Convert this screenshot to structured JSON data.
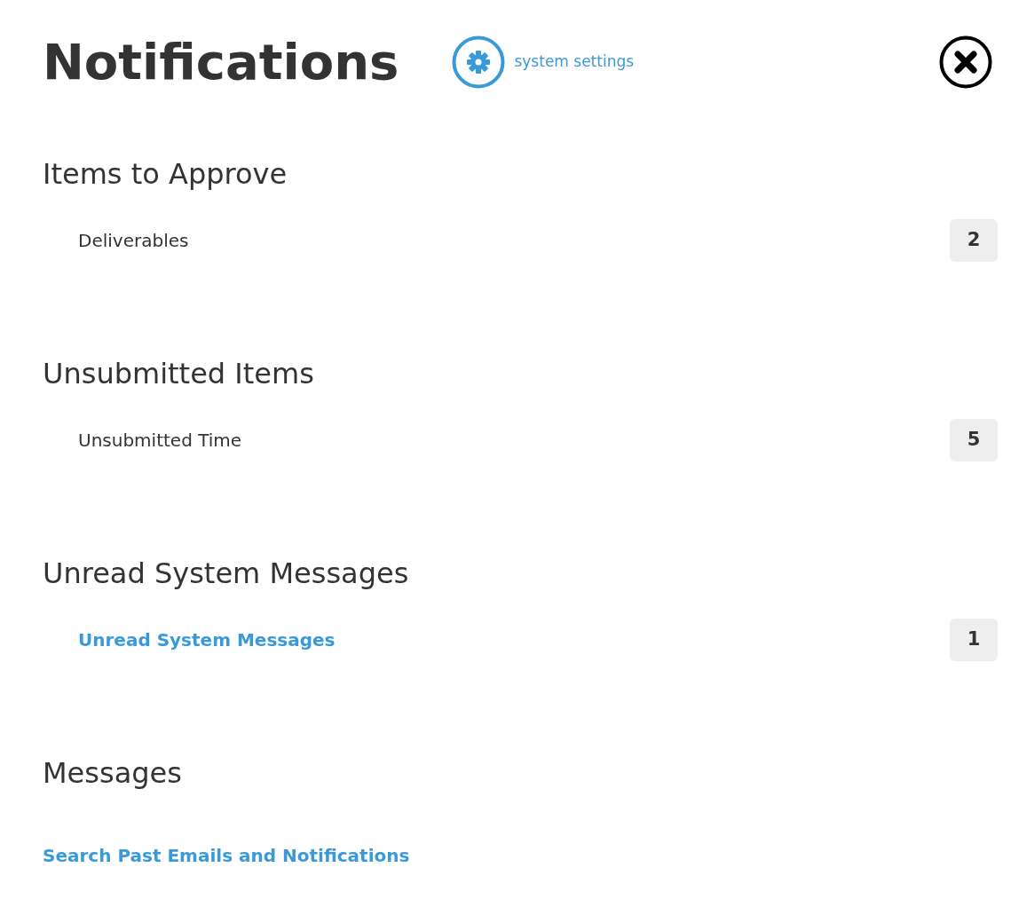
{
  "title": "Notifications",
  "settings_link": "system settings",
  "sections": [
    {
      "heading": "Items to Approve",
      "items": [
        {
          "label": "Deliverables",
          "kind": "text",
          "count": "2"
        }
      ]
    },
    {
      "heading": "Unsubmitted Items",
      "items": [
        {
          "label": "Unsubmitted Time",
          "kind": "text",
          "count": "5"
        }
      ]
    },
    {
      "heading": "Unread System Messages",
      "items": [
        {
          "label": "Unread System Messages",
          "kind": "link",
          "count": "1"
        }
      ]
    },
    {
      "heading": "Messages",
      "link": "Search Past Emails and Notifications"
    }
  ]
}
